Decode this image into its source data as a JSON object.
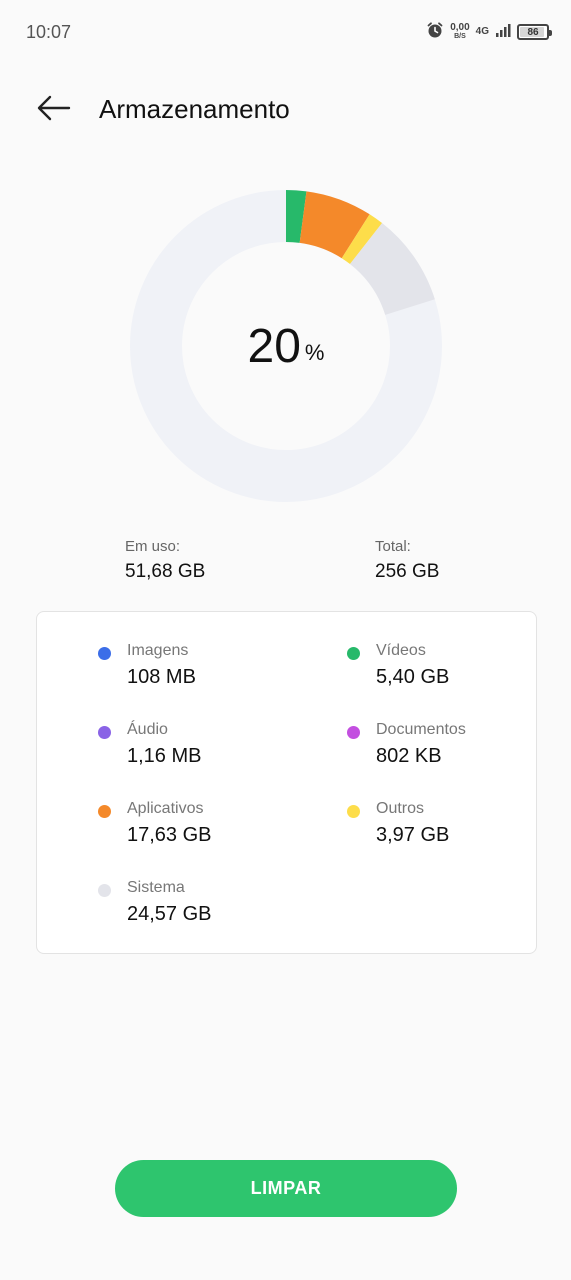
{
  "status_bar": {
    "time": "10:07",
    "net_speed_value": "0,00",
    "net_speed_unit": "B/S",
    "network_type": "4G",
    "battery_level": "86",
    "battery_fraction": 0.86
  },
  "header": {
    "title": "Armazenamento"
  },
  "usage": {
    "percent_value": "20",
    "percent_sign": "%",
    "used_label": "Em uso:",
    "used_value": "51,68 GB",
    "total_label": "Total:",
    "total_value": "256 GB"
  },
  "categories": [
    {
      "name": "Imagens",
      "size": "108 MB",
      "color": "#3c6ee8"
    },
    {
      "name": "Vídeos",
      "size": "5,40 GB",
      "color": "#27b96a"
    },
    {
      "name": "Áudio",
      "size": "1,16 MB",
      "color": "#8a63e6"
    },
    {
      "name": "Documentos",
      "size": "802 KB",
      "color": "#c34fe0"
    },
    {
      "name": "Aplicativos",
      "size": "17,63 GB",
      "color": "#f4892a"
    },
    {
      "name": "Outros",
      "size": "3,97 GB",
      "color": "#fddd4a"
    },
    {
      "name": "Sistema",
      "size": "24,57 GB",
      "color": "#e3e4ea"
    }
  ],
  "donut": {
    "track_color": "#f0f2f7",
    "segments": [
      {
        "category": "Vídeos",
        "fraction": 0.021,
        "color": "#27b96a"
      },
      {
        "category": "Aplicativos",
        "fraction": 0.069,
        "color": "#f4892a"
      },
      {
        "category": "Outros",
        "fraction": 0.0155,
        "color": "#fddd4a"
      },
      {
        "category": "Sistema",
        "fraction": 0.096,
        "color": "#e3e4ea"
      }
    ]
  },
  "actions": {
    "clean_label": "LIMPAR"
  },
  "icons": {
    "back": "arrow-left-icon",
    "alarm": "alarm-icon",
    "signal": "signal-bars-icon",
    "battery": "battery-icon"
  }
}
